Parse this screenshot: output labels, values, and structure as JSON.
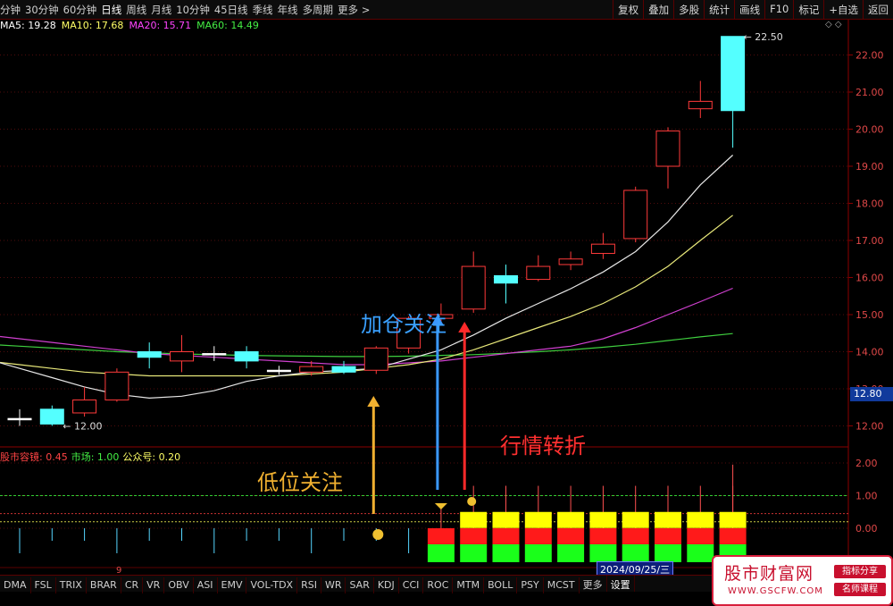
{
  "top_bar": {
    "periods": [
      "分钟",
      "30分钟",
      "60分钟",
      "日线",
      "周线",
      "月线",
      "10分钟",
      "45日线",
      "季线",
      "年线",
      "多周期",
      "更多 >"
    ],
    "active_period": "日线",
    "tools": [
      "复权",
      "叠加",
      "多股",
      "统计",
      "画线",
      "F10",
      "标记",
      "+自选",
      "返回"
    ]
  },
  "ma_legend": [
    {
      "label": "MA5: 19.28",
      "color": "#ffffff"
    },
    {
      "label": "MA10: 17.68",
      "color": "#ffff66"
    },
    {
      "label": "MA20: 15.71",
      "color": "#ff44ff"
    },
    {
      "label": "MA60: 14.49",
      "color": "#44ee44"
    }
  ],
  "price_axis": [
    "22.00",
    "21.00",
    "20.00",
    "19.00",
    "18.00",
    "17.00",
    "16.00",
    "15.00",
    "14.00",
    "13.00",
    "12.00"
  ],
  "current_price": "12.80",
  "high_label": "22.50",
  "low_label": "12.00",
  "sub_legend": [
    {
      "label": "股市容镜: 0.45",
      "color": "#ff4444"
    },
    {
      "label": "市场: 1.00",
      "color": "#44ee44"
    },
    {
      "label": "公众号: 0.20",
      "color": "#ffff66"
    }
  ],
  "sub_axis": [
    "2.00",
    "1.00",
    "0.00"
  ],
  "annotations": {
    "low_focus": "低位关注",
    "add_position": "加仓关注",
    "turning": "行情转折"
  },
  "chart_data": {
    "type": "candlestick",
    "candles": [
      {
        "o": 12.2,
        "c": 12.2,
        "h": 12.45,
        "l": 12.0
      },
      {
        "o": 12.45,
        "c": 12.05,
        "h": 12.55,
        "l": 12.0
      },
      {
        "o": 12.35,
        "c": 12.7,
        "h": 13.05,
        "l": 12.25
      },
      {
        "o": 12.7,
        "c": 13.45,
        "h": 13.55,
        "l": 12.65
      },
      {
        "o": 14.0,
        "c": 13.85,
        "h": 14.25,
        "l": 13.55
      },
      {
        "o": 13.75,
        "c": 14.0,
        "h": 14.45,
        "l": 13.45
      },
      {
        "o": 13.95,
        "c": 13.95,
        "h": 14.15,
        "l": 13.75
      },
      {
        "o": 14.0,
        "c": 13.75,
        "h": 14.15,
        "l": 13.55
      },
      {
        "o": 13.5,
        "c": 13.5,
        "h": 13.62,
        "l": 13.38
      },
      {
        "o": 13.45,
        "c": 13.6,
        "h": 13.75,
        "l": 13.35
      },
      {
        "o": 13.6,
        "c": 13.45,
        "h": 13.75,
        "l": 13.4
      },
      {
        "o": 13.5,
        "c": 14.1,
        "h": 14.15,
        "l": 13.4
      },
      {
        "o": 14.1,
        "c": 14.9,
        "h": 14.95,
        "l": 13.95
      },
      {
        "o": 14.9,
        "c": 15.0,
        "h": 15.3,
        "l": 14.75
      },
      {
        "o": 15.15,
        "c": 16.3,
        "h": 16.7,
        "l": 15.05
      },
      {
        "o": 16.05,
        "c": 15.85,
        "h": 16.35,
        "l": 15.3
      },
      {
        "o": 15.95,
        "c": 16.3,
        "h": 16.6,
        "l": 15.9
      },
      {
        "o": 16.35,
        "c": 16.5,
        "h": 16.7,
        "l": 16.2
      },
      {
        "o": 16.65,
        "c": 16.9,
        "h": 17.2,
        "l": 16.5
      },
      {
        "o": 17.05,
        "c": 18.35,
        "h": 18.45,
        "l": 16.95
      },
      {
        "o": 19.0,
        "c": 19.95,
        "h": 20.05,
        "l": 18.4
      },
      {
        "o": 20.55,
        "c": 20.75,
        "h": 21.3,
        "l": 20.3
      },
      {
        "o": 22.5,
        "c": 20.5,
        "h": 22.5,
        "l": 19.5
      }
    ],
    "ma5": [
      13.55,
      13.3,
      13.05,
      12.85,
      12.75,
      12.8,
      12.95,
      13.2,
      13.35,
      13.45,
      13.5,
      13.55,
      13.8,
      14.05,
      14.45,
      14.9,
      15.3,
      15.7,
      16.15,
      16.7,
      17.5,
      18.5,
      19.3
    ],
    "ma10": [
      13.65,
      13.55,
      13.45,
      13.4,
      13.35,
      13.35,
      13.35,
      13.35,
      13.35,
      13.4,
      13.45,
      13.55,
      13.65,
      13.8,
      14.05,
      14.35,
      14.65,
      14.95,
      15.3,
      15.75,
      16.3,
      17.0,
      17.68
    ],
    "ma20": [
      14.35,
      14.25,
      14.15,
      14.05,
      13.95,
      13.9,
      13.85,
      13.8,
      13.75,
      13.7,
      13.65,
      13.65,
      13.7,
      13.75,
      13.85,
      13.95,
      14.05,
      14.15,
      14.35,
      14.65,
      15.0,
      15.35,
      15.71
    ],
    "ma60": [
      14.15,
      14.1,
      14.05,
      14.0,
      13.97,
      13.94,
      13.92,
      13.9,
      13.89,
      13.88,
      13.87,
      13.87,
      13.88,
      13.9,
      13.92,
      13.96,
      14.0,
      14.05,
      14.12,
      14.2,
      14.3,
      14.4,
      14.49
    ],
    "sub_blocks": [
      0,
      0,
      0,
      0,
      0,
      0,
      0,
      0,
      0,
      0,
      0,
      0,
      0,
      1,
      2,
      2,
      2,
      2,
      2,
      2,
      2,
      2,
      2
    ],
    "date_label": "2024/09/25/三"
  },
  "bottom_bar": {
    "tabs": [
      "DMA",
      "FSL",
      "TRIX",
      "BRAR",
      "CR",
      "VR",
      "OBV",
      "ASI",
      "EMV",
      "VOL-TDX",
      "RSI",
      "WR",
      "SAR",
      "KDJ",
      "CCI",
      "ROC",
      "MTM",
      "BOLL",
      "PSY",
      "MCST",
      "更多",
      "设置"
    ]
  },
  "watermark": {
    "title": "股市财富网",
    "url": "WWW.GSCFW.COM",
    "btn1": "指标分享",
    "btn2": "名师课程"
  }
}
